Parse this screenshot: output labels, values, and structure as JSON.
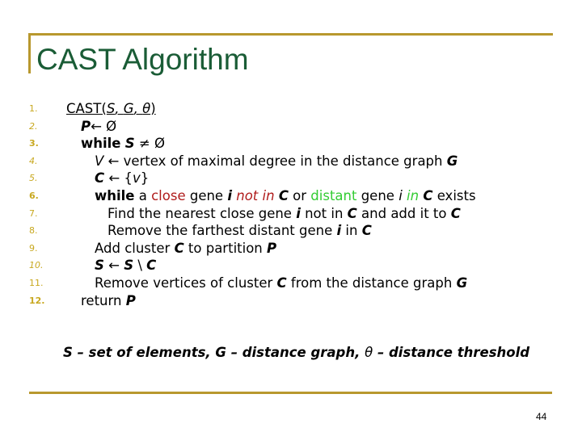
{
  "slide": {
    "title": "CAST Algorithm",
    "page_number": "44",
    "colors": {
      "accent_gold": "#b8982e",
      "title_green": "#1a5c36",
      "line_number_gold": "#c8a820",
      "close_red": "#b01c1c",
      "distant_green": "#33cc33"
    }
  },
  "algorithm": {
    "line_numbers": [
      "1.",
      "2.",
      "3.",
      "4.",
      "5.",
      "6.",
      "7.",
      "8.",
      "9.",
      "10.",
      "11.",
      "12."
    ],
    "l1": {
      "text": "CAST(",
      "s": "S",
      "sep1": ", ",
      "g": "G",
      "sep2": ", ",
      "theta": "θ",
      "close": ")"
    },
    "l2": {
      "p": "P",
      "arrow": "← Ø"
    },
    "l3": {
      "kw": "while",
      "s": "S",
      "rest": " ≠ Ø"
    },
    "l4": {
      "v": "V",
      "rest": " ← vertex of maximal degree in the distance graph ",
      "g": "G"
    },
    "l5": {
      "c": "C",
      "rest": " ← {",
      "v": "v",
      "end": "}"
    },
    "l6": {
      "kw": "while",
      "a": " a ",
      "close": "close",
      "gene": " gene ",
      "i1": "i",
      "notin": "  not in ",
      "c1": "C",
      "or": " or ",
      "distant": "distant",
      "gene2": " gene ",
      "i2": "i",
      "in": " in ",
      "c2": "C",
      "exists": " exists"
    },
    "l7": {
      "t1": "Find the nearest close gene ",
      "i": "i",
      "t2": " not in ",
      "c1": "C",
      "t3": " and add it to ",
      "c2": "C"
    },
    "l8": {
      "t1": "Remove the farthest distant gene ",
      "i": "i",
      "t2": " in ",
      "c": "C"
    },
    "l9": {
      "t1": "Add cluster ",
      "c": "C",
      "t2": " to partition ",
      "p": "P"
    },
    "l10": {
      "s1": "S",
      "arrow": " ← ",
      "s2": "S",
      "minus": " \\ ",
      "c": "C"
    },
    "l11": {
      "t1": "Remove vertices of cluster ",
      "c": "C",
      "t2": " from the distance graph ",
      "g": "G"
    },
    "l12": {
      "t1": "return ",
      "p": "P"
    }
  },
  "legend": {
    "part1": "S – set of elements, G – distance graph, ",
    "theta": "θ",
    "part2": " – distance threshold"
  }
}
